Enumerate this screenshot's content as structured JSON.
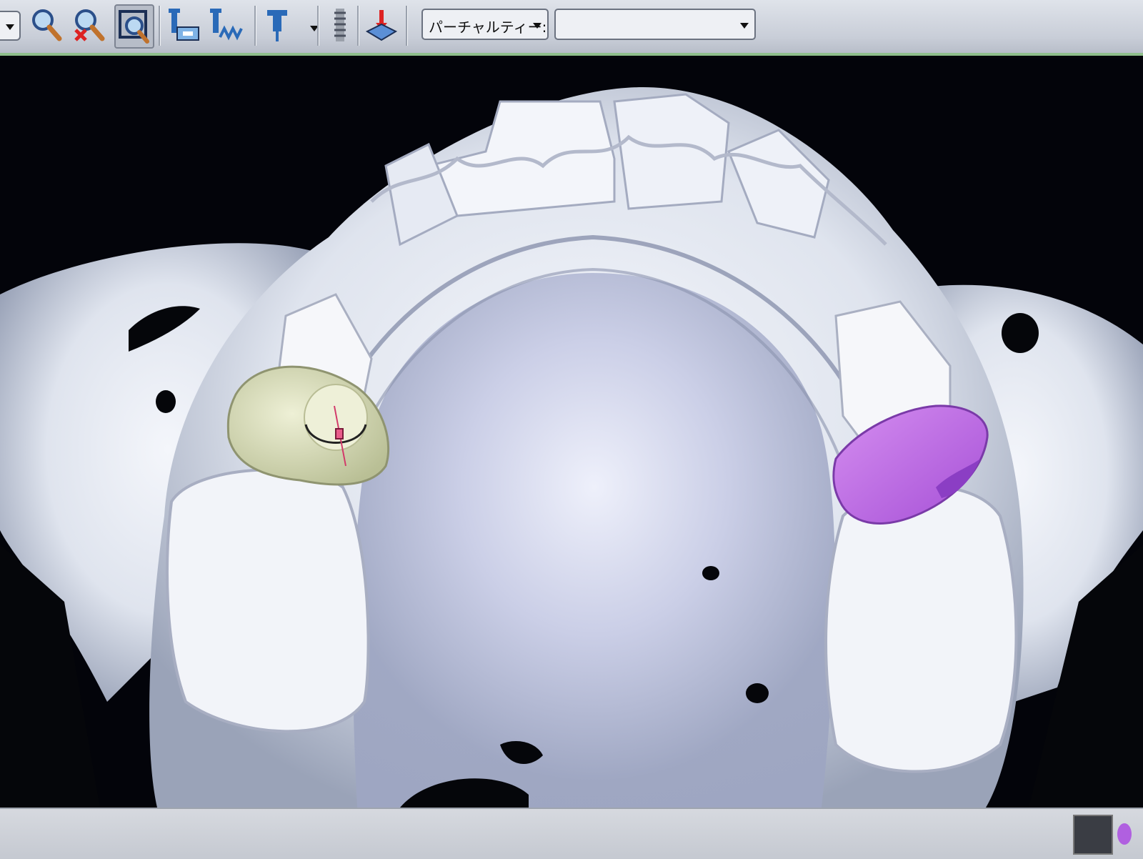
{
  "toolbar": {
    "buttons": [
      {
        "name": "dropdown-arrow-icon"
      },
      {
        "name": "zoom-icon"
      },
      {
        "name": "zoom-reset-icon"
      },
      {
        "name": "zoom-window-icon"
      },
      {
        "name": "implant-place-icon"
      },
      {
        "name": "implant-multi-icon"
      },
      {
        "name": "implant-tool-icon"
      },
      {
        "name": "screw-icon"
      },
      {
        "name": "direction-icon"
      }
    ],
    "mode_dropdown_value": "パーチャルティー:",
    "second_dropdown_value": ""
  },
  "viewport": {
    "colors": {
      "bone": "#e7ebf3",
      "bone_shadow": "#8f97ac",
      "implant_green": "#d8dcb8",
      "implant_purple": "#c77ae8"
    }
  }
}
